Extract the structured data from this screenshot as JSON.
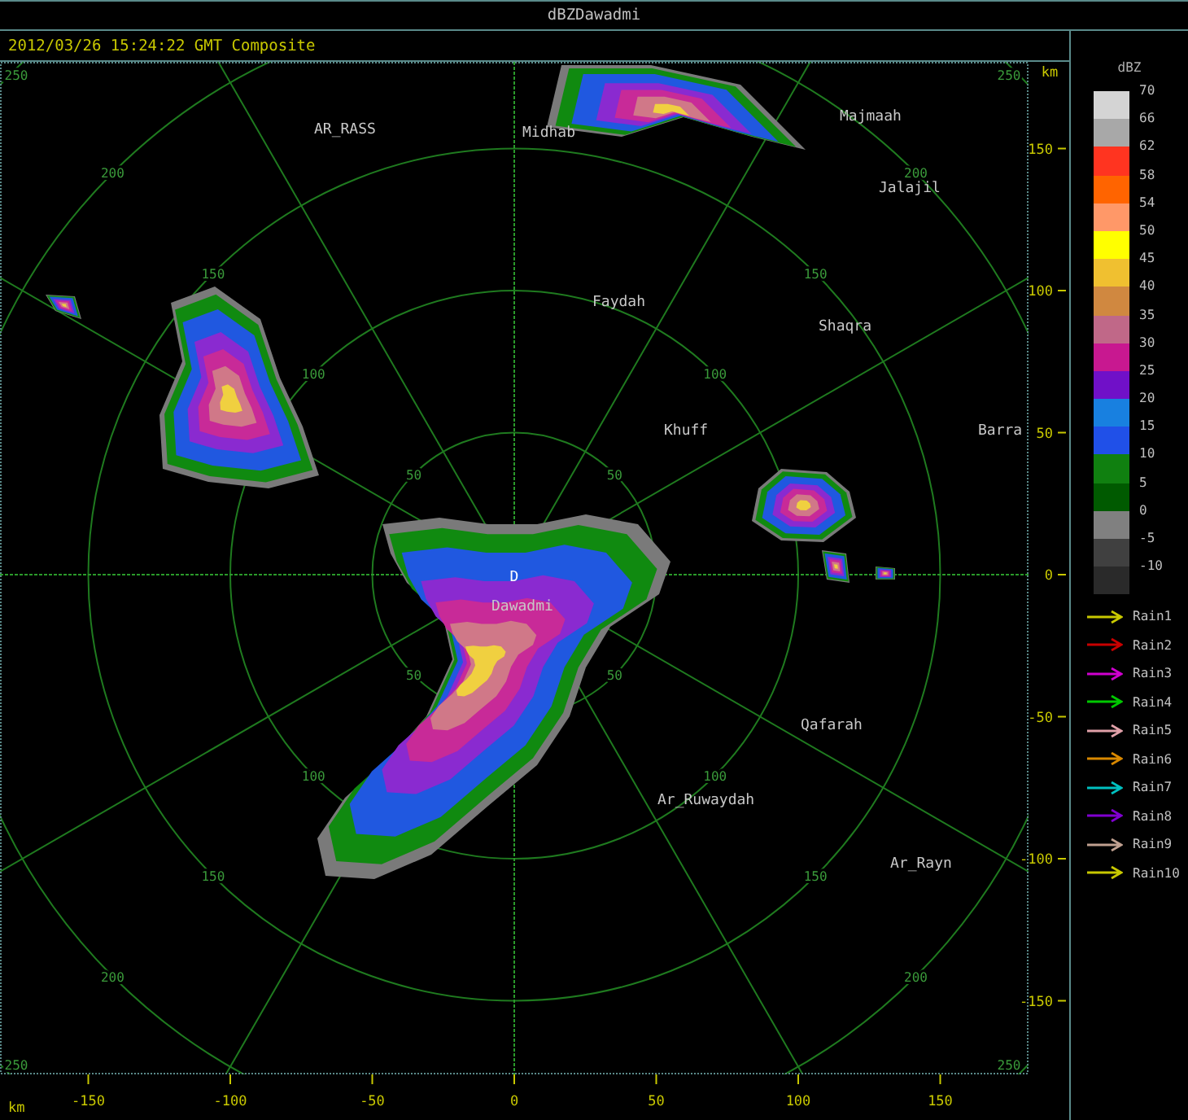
{
  "window": {
    "title": "dBZDawadmi"
  },
  "header": {
    "timestamp": "2012/03/26 15:24:22 GMT Composite"
  },
  "radar": {
    "site_marker": "D",
    "rings": [
      {
        "labels": [
          "50",
          "50",
          "50",
          "50"
        ]
      },
      {
        "labels": [
          "100",
          "100",
          "100",
          "100"
        ]
      },
      {
        "labels": [
          "150",
          "150",
          "150",
          "150"
        ]
      },
      {
        "labels": [
          "200",
          "200",
          "200",
          "200"
        ]
      },
      {
        "labels": [
          "250",
          "250",
          "250",
          "250"
        ]
      }
    ],
    "places": [
      {
        "name": "AR_RASS"
      },
      {
        "name": "Midhab"
      },
      {
        "name": "Majmaah"
      },
      {
        "name": "Jalajil"
      },
      {
        "name": "Faydah"
      },
      {
        "name": "Shaqra"
      },
      {
        "name": "Khuff"
      },
      {
        "name": "Barra"
      },
      {
        "name": "Dawadmi"
      },
      {
        "name": "Qafarah"
      },
      {
        "name": "Ar_Ruwaydah"
      },
      {
        "name": "Ar_Rayn"
      }
    ]
  },
  "y_axis": {
    "unit": "km",
    "ticks": [
      "150",
      "100",
      "50",
      "0",
      "-50",
      "-100",
      "-150"
    ]
  },
  "x_axis": {
    "unit": "km",
    "ticks": [
      "-150",
      "-100",
      "-50",
      "0",
      "50",
      "100",
      "150"
    ]
  },
  "legend": {
    "title": "dBZ",
    "scale": [
      {
        "label": "70",
        "color": "#d4d4d4"
      },
      {
        "label": "66",
        "color": "#a8a8a8"
      },
      {
        "label": "62",
        "color": "#ff3420"
      },
      {
        "label": "58",
        "color": "#ff6400"
      },
      {
        "label": "54",
        "color": "#ff9868"
      },
      {
        "label": "50",
        "color": "#ffff00"
      },
      {
        "label": "45",
        "color": "#f0c030"
      },
      {
        "label": "40",
        "color": "#d08840"
      },
      {
        "label": "35",
        "color": "#c06888"
      },
      {
        "label": "30",
        "color": "#c81890"
      },
      {
        "label": "25",
        "color": "#7010c8"
      },
      {
        "label": "20",
        "color": "#1880e0"
      },
      {
        "label": "15",
        "color": "#2050e8"
      },
      {
        "label": "10",
        "color": "#108010"
      },
      {
        "label": "5",
        "color": "#005a00"
      },
      {
        "label": "0",
        "color": "#808080"
      },
      {
        "label": "-5",
        "color": "#404040"
      },
      {
        "label": "-10",
        "color": "#2a2a2a"
      }
    ],
    "tracks": [
      {
        "label": "Rain1",
        "color": "#c8c800"
      },
      {
        "label": "Rain2",
        "color": "#c80000"
      },
      {
        "label": "Rain3",
        "color": "#d000d0"
      },
      {
        "label": "Rain4",
        "color": "#00c800"
      },
      {
        "label": "Rain5",
        "color": "#e0a0a8"
      },
      {
        "label": "Rain6",
        "color": "#d88800"
      },
      {
        "label": "Rain7",
        "color": "#00c0c0"
      },
      {
        "label": "Rain8",
        "color": "#8000d0"
      },
      {
        "label": "Rain9",
        "color": "#c0a090"
      },
      {
        "label": "Rain10",
        "color": "#c8c800"
      }
    ]
  }
}
